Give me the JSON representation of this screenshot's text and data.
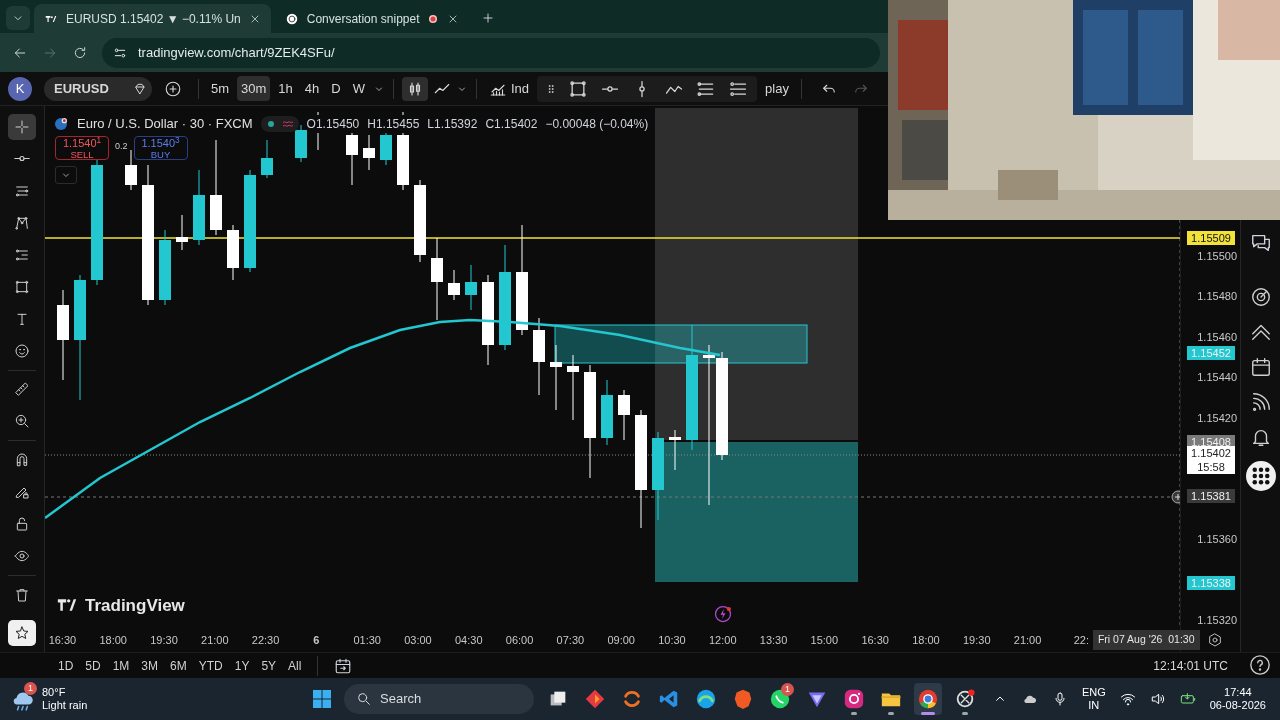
{
  "browser": {
    "tabs": [
      {
        "title": "EURUSD 1.15402 ▼ −0.11% Un",
        "selected": true,
        "recording": false
      },
      {
        "title": "Conversation snippet",
        "selected": false,
        "recording": true
      }
    ],
    "url": "tradingview.com/chart/9ZEK4SFu/",
    "forward_disabled": true
  },
  "toolbar": {
    "avatar": "K",
    "symbol": "EURUSD",
    "intervals": [
      {
        "label": "5m",
        "selected": false
      },
      {
        "label": "30m",
        "selected": true
      },
      {
        "label": "1h",
        "selected": false
      },
      {
        "label": "4h",
        "selected": false
      },
      {
        "label": "D",
        "selected": false
      },
      {
        "label": "W",
        "selected": false
      }
    ],
    "indicators": "Ind",
    "replay": "play"
  },
  "left_tools": [
    {
      "kind": "crosshair",
      "selected": true
    },
    {
      "kind": "hline",
      "selected": false
    },
    {
      "kind": "lines",
      "selected": false
    },
    {
      "kind": "pattern",
      "selected": false
    },
    {
      "kind": "fib",
      "selected": false
    },
    {
      "kind": "rect",
      "selected": false
    },
    {
      "kind": "text",
      "selected": false
    },
    {
      "kind": "emoji",
      "selected": false
    },
    {
      "kind": "sep"
    },
    {
      "kind": "ruler",
      "selected": false
    },
    {
      "kind": "zoom",
      "selected": false
    },
    {
      "kind": "sep"
    },
    {
      "kind": "magnet",
      "selected": false
    },
    {
      "kind": "pencil-lock",
      "selected": false
    },
    {
      "kind": "lock",
      "selected": false
    },
    {
      "kind": "eye",
      "selected": false
    },
    {
      "kind": "sep"
    },
    {
      "kind": "trash",
      "selected": false
    },
    {
      "kind": "star"
    }
  ],
  "legend": {
    "title": "Euro / U.S. Dollar · 30 · FXCM",
    "ohlc": [
      {
        "key": "O",
        "value": "1.15450"
      },
      {
        "key": "H",
        "value": "1.15455"
      },
      {
        "key": "L",
        "value": "1.15392"
      },
      {
        "key": "C",
        "value": "1.15402"
      }
    ],
    "change": "−0.00048 (−0.04%)"
  },
  "trade": {
    "sell_price": "1.1540$^{1}$",
    "sell_label": "SELL",
    "spread": "0.2",
    "buy_price": "1.1540$^{3}$",
    "buy_label": "BUY"
  },
  "logo": "TradingView",
  "price_axis": {
    "ticks": [
      "1.15500",
      "1.15480",
      "1.15460",
      "1.15440",
      "1.15420",
      "1.15360",
      "1.15320"
    ],
    "markers": [
      {
        "label": "1.15509",
        "color": "#f2e33a"
      },
      {
        "label": "1.15452",
        "color": "#22c7cf"
      },
      {
        "label": "1.15408",
        "color": "#7a7a7a"
      },
      {
        "label": "1.15402",
        "sublabel": "15:58",
        "color": "#ffffff"
      },
      {
        "label": "1.15381",
        "color": "#3a3a3a"
      },
      {
        "label": "1.15338",
        "color": "#22c7cf"
      }
    ]
  },
  "time_axis": {
    "labels": [
      {
        "text": "16:30",
        "bold": false
      },
      {
        "text": "18:00",
        "bold": false
      },
      {
        "text": "19:30",
        "bold": false
      },
      {
        "text": "21:00",
        "bold": false
      },
      {
        "text": "22:30",
        "bold": false
      },
      {
        "text": "6",
        "bold": true
      },
      {
        "text": "01:30",
        "bold": false
      },
      {
        "text": "03:00",
        "bold": false
      },
      {
        "text": "04:30",
        "bold": false
      },
      {
        "text": "06:00",
        "bold": false
      },
      {
        "text": "07:30",
        "bold": false
      },
      {
        "text": "09:00",
        "bold": false
      },
      {
        "text": "10:30",
        "bold": false
      },
      {
        "text": "12:00",
        "bold": false
      },
      {
        "text": "13:30",
        "bold": false
      },
      {
        "text": "15:00",
        "bold": false
      },
      {
        "text": "16:30",
        "bold": false
      },
      {
        "text": "18:00",
        "bold": false
      },
      {
        "text": "19:30",
        "bold": false
      },
      {
        "text": "21:00",
        "bold": false
      },
      {
        "text": "22:",
        "bold": false
      }
    ],
    "crosshair_label": "Fri 07 Aug '26  01:30"
  },
  "ranges": [
    "1D",
    "5D",
    "1M",
    "3M",
    "6M",
    "YTD",
    "1Y",
    "5Y",
    "All"
  ],
  "clock": "12:14:01 UTC",
  "taskbar": {
    "weather": {
      "temp": "80°F",
      "condition": "Light rain",
      "badge": "1"
    },
    "search": "Search",
    "apps": [
      {
        "kind": "taskview",
        "running": false
      },
      {
        "kind": "diamond",
        "running": false
      },
      {
        "kind": "swirl",
        "running": false
      },
      {
        "kind": "code",
        "running": false
      },
      {
        "kind": "browser-wave",
        "running": false
      },
      {
        "kind": "lion",
        "running": false
      },
      {
        "kind": "chat",
        "running": false,
        "badge": "1"
      },
      {
        "kind": "prism",
        "running": false
      },
      {
        "kind": "camera",
        "running": true
      },
      {
        "kind": "folder",
        "running": true
      },
      {
        "kind": "chrome",
        "running": true,
        "selected": true
      },
      {
        "kind": "knot",
        "running": true
      }
    ],
    "lang": "ENG",
    "region": "IN",
    "time": "17:44",
    "date": "06-08-2026"
  }
}
